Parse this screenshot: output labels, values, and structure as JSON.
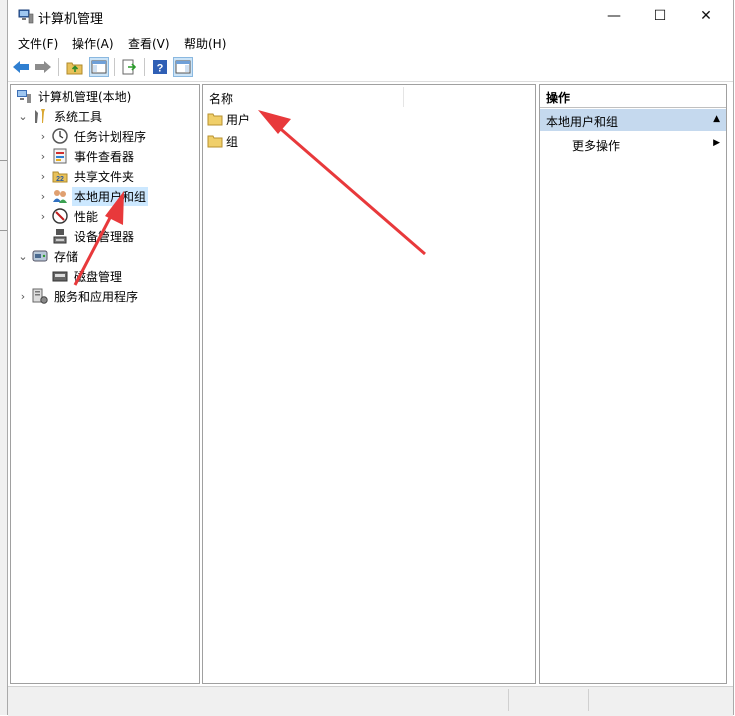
{
  "window": {
    "title": "计算机管理",
    "minimize_icon": "—",
    "maximize_icon": "☐",
    "close_icon": "✕"
  },
  "menu": {
    "items": [
      "文件(F)",
      "操作(A)",
      "查看(V)",
      "帮助(H)"
    ]
  },
  "tree": {
    "root": "计算机管理(本地)",
    "system_tools": "系统工具",
    "task_scheduler": "任务计划程序",
    "event_viewer": "事件查看器",
    "shared_folders": "共享文件夹",
    "local_users_groups": "本地用户和组",
    "performance": "性能",
    "device_manager": "设备管理器",
    "storage": "存储",
    "disk_management": "磁盘管理",
    "services_apps": "服务和应用程序"
  },
  "list": {
    "column_name": "名称",
    "items": [
      "用户",
      "组"
    ]
  },
  "actions": {
    "header": "操作",
    "section": "本地用户和组",
    "more": "更多操作"
  },
  "colors": {
    "selection": "#cce8ff",
    "action_section": "#c5d9ee",
    "arrow": "#e8393b"
  }
}
